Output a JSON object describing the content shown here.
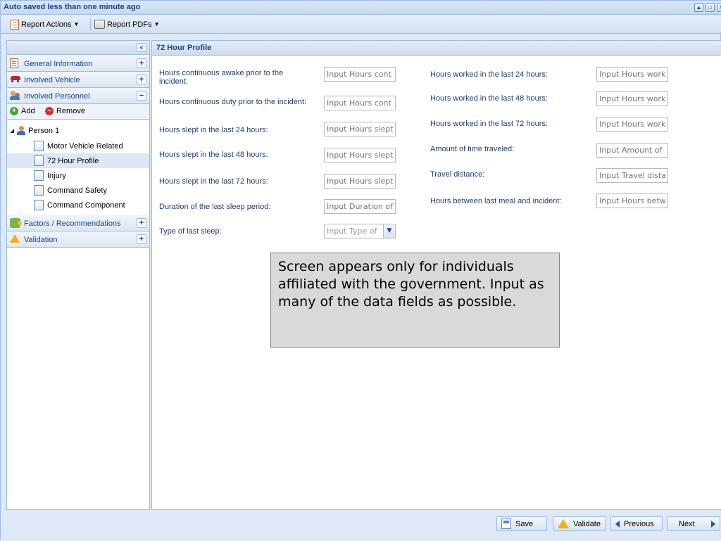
{
  "window": {
    "title": "Auto saved less than one minute ago",
    "controls": [
      "▲",
      "□",
      "✕"
    ]
  },
  "toolbar": {
    "report_actions_label": "Report Actions",
    "report_pdfs_label": "Report PDFs"
  },
  "sidebar": {
    "collapse_glyph": "«",
    "sections": [
      {
        "label": "General Information",
        "toggle": "+",
        "icon": "document-icon"
      },
      {
        "label": "Involved Vehicle",
        "toggle": "+",
        "icon": "vehicle-icon"
      },
      {
        "label": "Involved Personnel",
        "toggle": "−",
        "icon": "personnel-icon"
      }
    ],
    "add_label": "Add",
    "remove_label": "Remove",
    "person_label": "Person 1",
    "items": [
      {
        "label": "Motor Vehicle Related"
      },
      {
        "label": "72 Hour Profile"
      },
      {
        "label": "Injury"
      },
      {
        "label": "Command Safety"
      },
      {
        "label": "Command Component"
      }
    ],
    "lower_sections": [
      {
        "label": "Factors / Recommendations",
        "toggle": "+",
        "icon": "puzzle-icon"
      },
      {
        "label": "Validation",
        "toggle": "+",
        "icon": "warning-icon"
      }
    ]
  },
  "main": {
    "title": "72 Hour Profile",
    "left_fields": [
      {
        "label": "Hours continuous awake prior to the incident:",
        "placeholder": "Input Hours cont"
      },
      {
        "label": "Hours continuous duty prior to the incident:",
        "placeholder": "Input Hours cont"
      },
      {
        "label": "Hours slept in the last 24 hours:",
        "placeholder": "Input Hours slept"
      },
      {
        "label": "Hours slept in the last 48 hours:",
        "placeholder": "Input Hours slept"
      },
      {
        "label": "Hours slept in the last 72 hours:",
        "placeholder": "Input Hours slept"
      },
      {
        "label": "Duration of the last sleep period:",
        "placeholder": "Input Duration of"
      },
      {
        "label": "Type of last sleep:",
        "placeholder": "Input Type of"
      }
    ],
    "right_fields": [
      {
        "label": "Hours worked in the last 24 hours:",
        "placeholder": "Input Hours work"
      },
      {
        "label": "Hours worked in the last 48 hours:",
        "placeholder": "Input Hours work"
      },
      {
        "label": "Hours worked in the last 72 hours:",
        "placeholder": "Input Hours work"
      },
      {
        "label": "Amount of time traveled:",
        "placeholder": "Input Amount of"
      },
      {
        "label": "Travel distance:",
        "placeholder": "Input Travel dista"
      },
      {
        "label": "Hours between last meal and incident:",
        "placeholder": "Input Hours betw"
      }
    ]
  },
  "note": {
    "text": "Screen appears only for individuals affiliated with the government. Input as many of the data fields as possible."
  },
  "footer": {
    "save_label": "Save",
    "validate_label": "Validate",
    "previous_label": "Previous",
    "next_label": "Next"
  },
  "colors": {
    "accent": "#15428b",
    "border": "#99bbe8",
    "panel_bg": "#dfe8f6"
  }
}
